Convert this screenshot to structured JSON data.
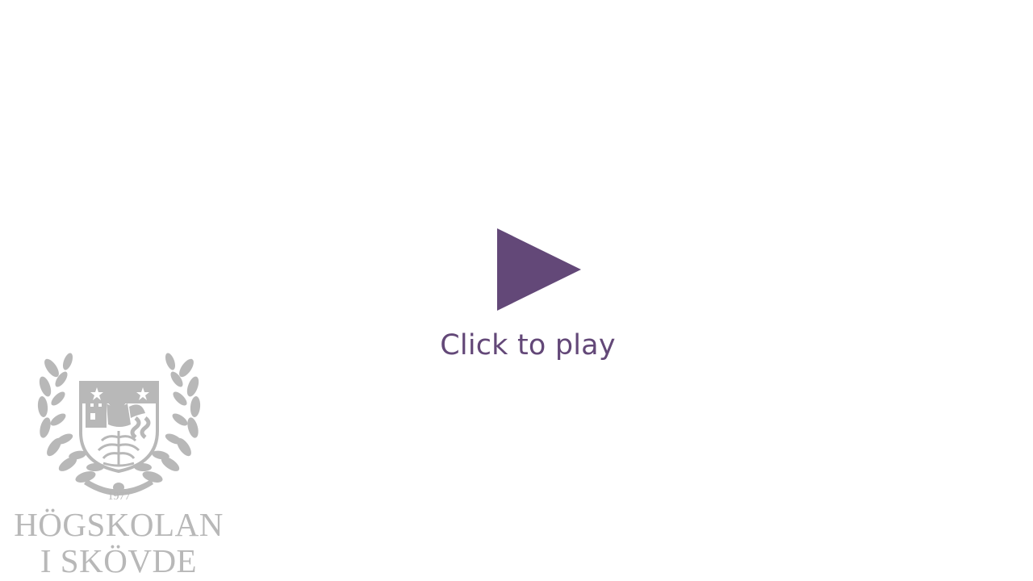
{
  "player": {
    "play_label": "Click to play",
    "accent_color": "#634878",
    "icon": "play-triangle-icon"
  },
  "logo": {
    "year": "1977",
    "line1": "HÖGSKOLAN",
    "line2": "I SKÖVDE",
    "color": "#b8b8b8",
    "icon": "university-seal"
  }
}
